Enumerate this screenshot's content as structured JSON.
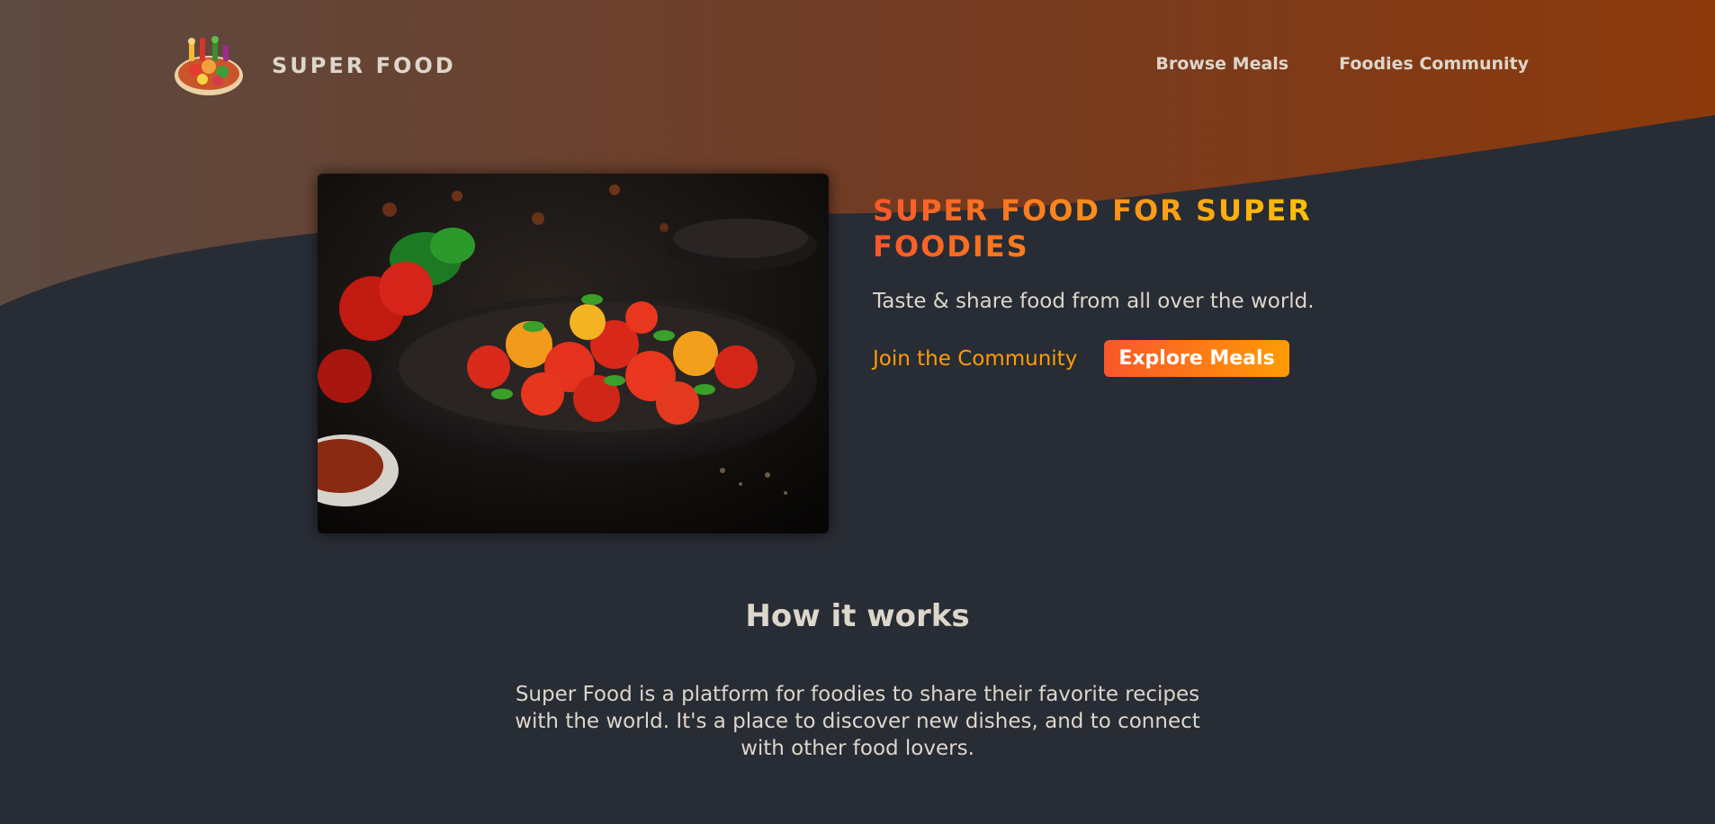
{
  "brand": {
    "name": "SUPER FOOD",
    "logo_icon": "food-plate-logo"
  },
  "nav": {
    "items": [
      {
        "label": "Browse Meals"
      },
      {
        "label": "Foodies Community"
      }
    ]
  },
  "hero": {
    "image_icon": "tomato-salad-photo",
    "title": "SUPER FOOD FOR SUPER FOODIES",
    "subtitle": "Taste & share food from all over the world.",
    "community_link": "Join the Community",
    "explore_button": "Explore Meals"
  },
  "how_it_works": {
    "title": "How it works",
    "paragraph_1": "Super Food is a platform for foodies to share their favorite recipes with the world. It's a place to discover new dishes, and to connect with other food lovers.",
    "paragraph_2": ""
  },
  "colors": {
    "background": "#282c34",
    "accent_start": "#f9572a",
    "accent_end": "#ffc905",
    "header_gradient_start": "#5a4a42",
    "header_gradient_end": "#8a3a10",
    "text": "#ddd6cb",
    "link": "#ff9b05"
  }
}
